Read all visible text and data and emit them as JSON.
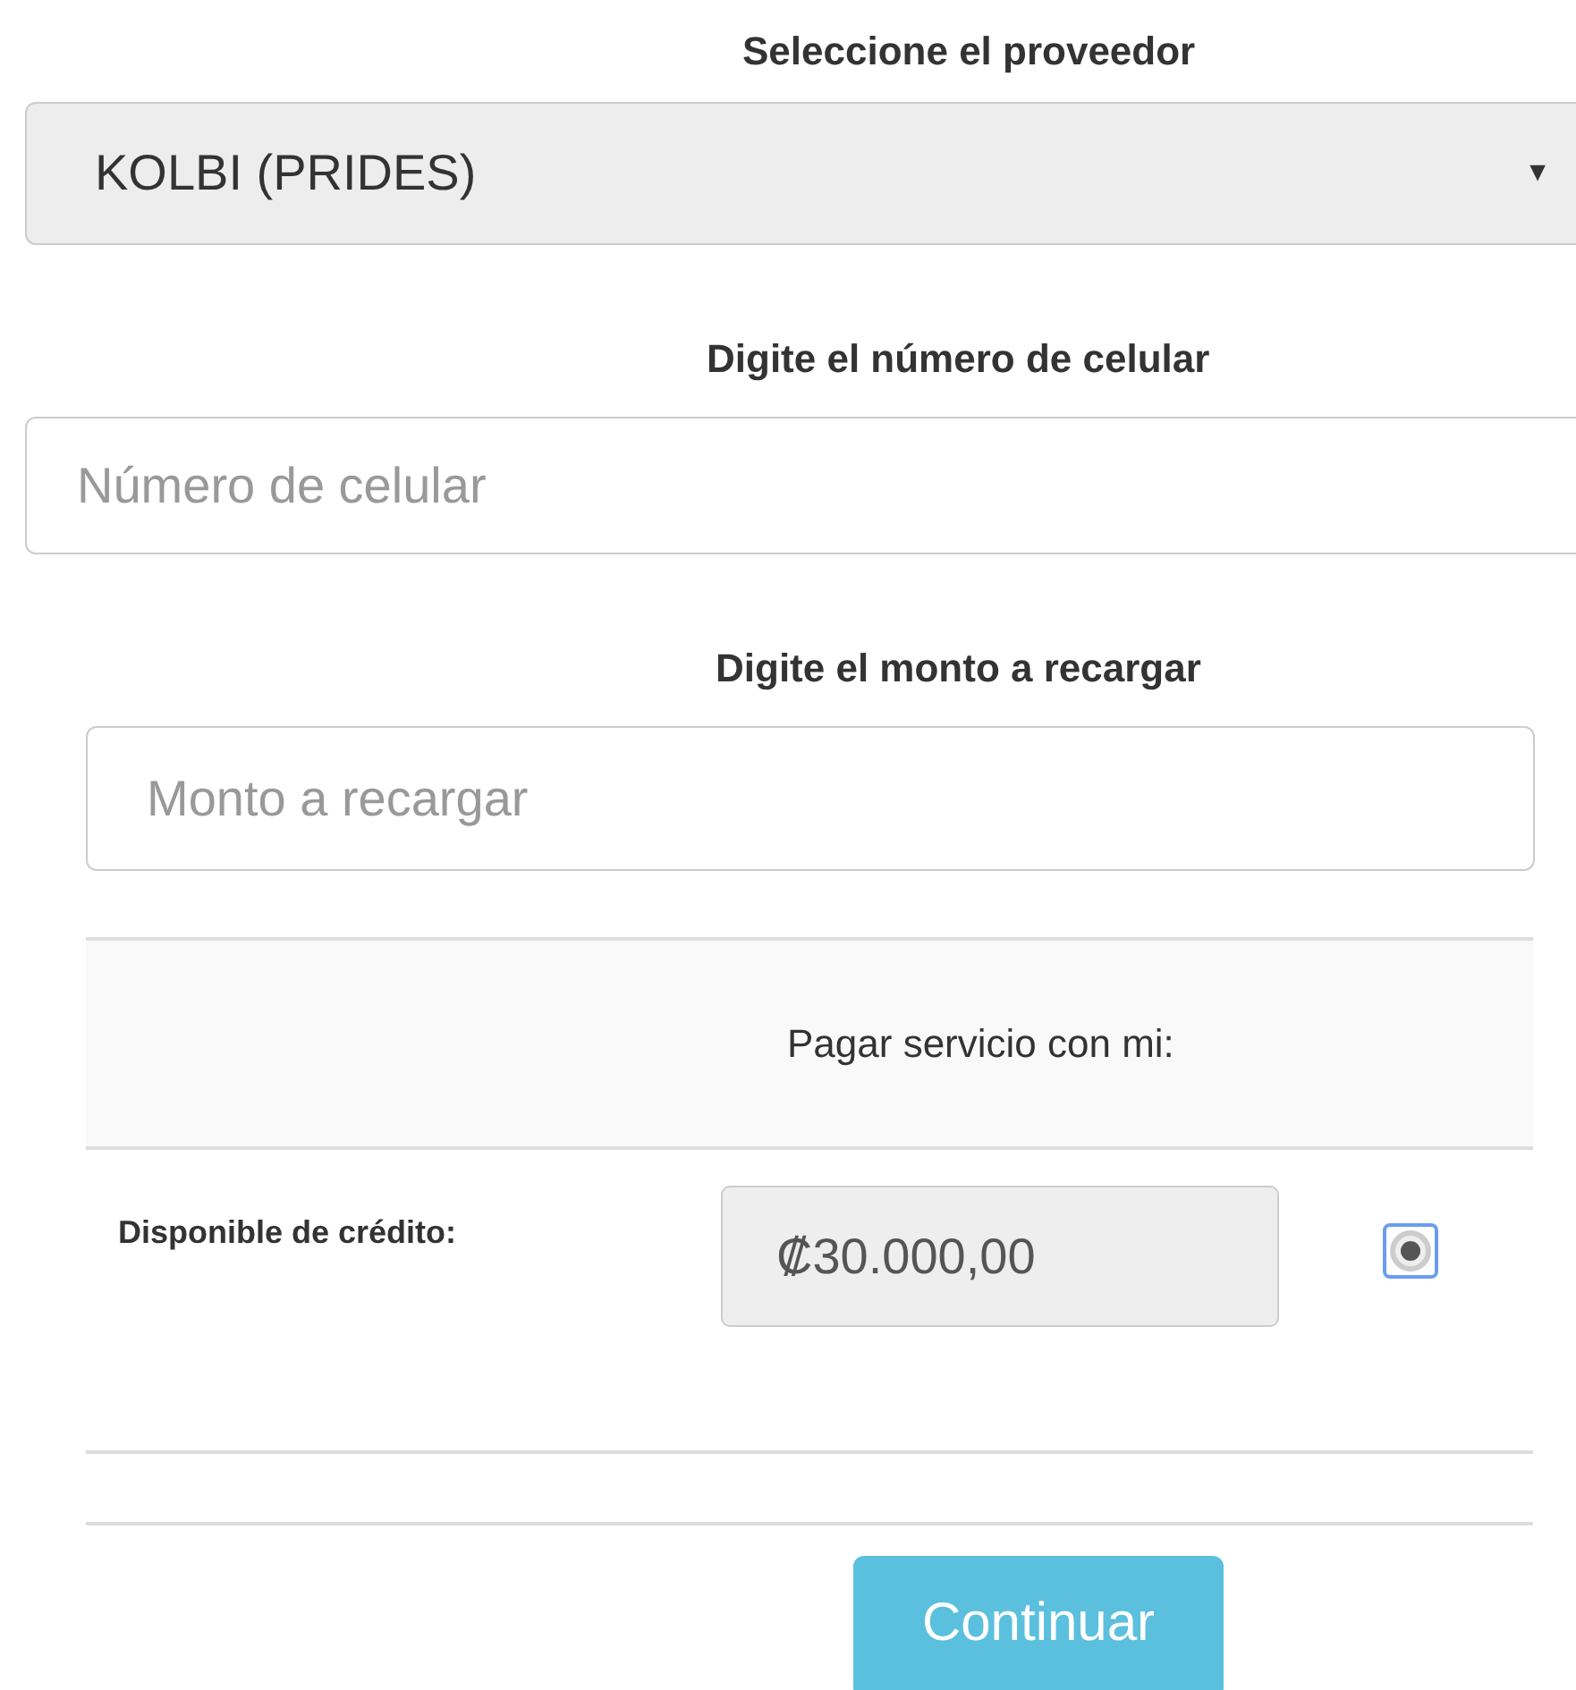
{
  "provider": {
    "label": "Seleccione el proveedor",
    "value": "KOLBI (PRIDES)",
    "arrow": "▼"
  },
  "phone": {
    "label": "Digite el número de celular",
    "placeholder": "Número de celular"
  },
  "amount": {
    "label": "Digite el monto a recargar",
    "placeholder": "Monto a recargar"
  },
  "payment": {
    "header": "Pagar servicio con mi:",
    "options": [
      {
        "label": "Disponible de crédito:",
        "value": "₡30.000,00",
        "selected": true
      }
    ]
  },
  "button": "Continuar"
}
